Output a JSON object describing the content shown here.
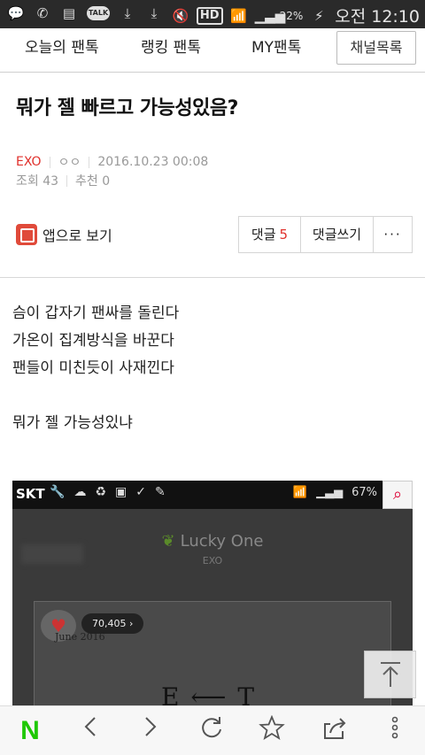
{
  "status": {
    "battery_pct": "22%",
    "time": "오전 12:10",
    "talk": "TALK",
    "hd": "HD"
  },
  "nav": {
    "tabs": [
      "오늘의 팬톡",
      "랭킹 팬톡",
      "MY팬톡"
    ],
    "channel_list": "채널목록"
  },
  "post": {
    "title": "뭐가 젤 빠르고 가능성있음?",
    "channel": "EXO",
    "author": "ㅇㅇ",
    "datetime": "2016.10.23 00:08",
    "views": "조회 43",
    "recommend": "추천 0"
  },
  "actions": {
    "app_view": "앱으로 보기",
    "comments_label": "댓글",
    "comments_count": "5",
    "write_comment": "댓글쓰기",
    "more": "···"
  },
  "body": {
    "lines": [
      "슴이 갑자기 팬싸를 돌린다",
      "가온이 집계방식을 바꾼다",
      "팬들이 미친듯이 사재낀다",
      "",
      "뭐가 젤 가능성있냐"
    ]
  },
  "embed": {
    "carrier": "SKT",
    "battery": "67%",
    "song": "Lucky One",
    "artist": "EXO",
    "likes": "70,405",
    "date_text": "June 2016",
    "et_text": "E ⟵ T"
  },
  "bottom": {
    "naver": "N"
  }
}
